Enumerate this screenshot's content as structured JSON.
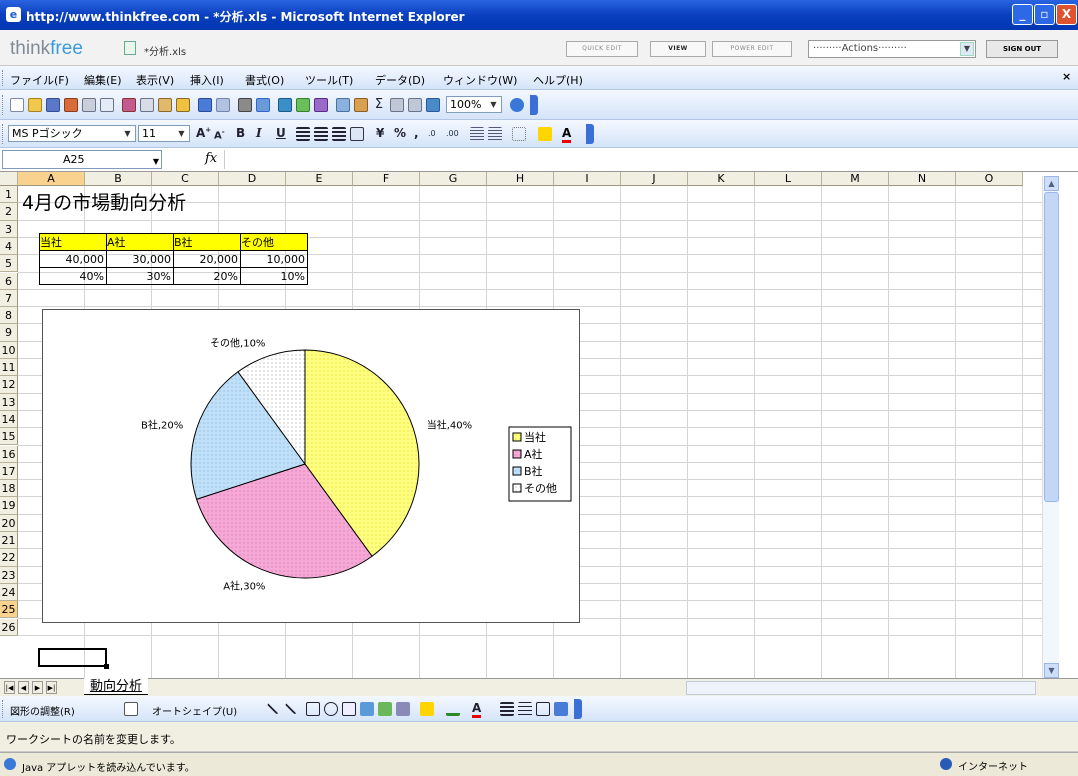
{
  "window": {
    "title": "http://www.thinkfree.com - *分析.xls - Microsoft Internet Explorer",
    "minimize": "_",
    "maximize": "▫",
    "close": "X"
  },
  "thinkfree": {
    "logo_a": "think",
    "logo_b": "free",
    "filename": "*分析.xls",
    "buttons": [
      "QUICK EDIT",
      "VIEW",
      "POWER EDIT"
    ],
    "actions": "·········Actions·········",
    "signout": "SIGN OUT"
  },
  "menu": [
    "ファイル(F)",
    "編集(E)",
    "表示(V)",
    "挿入(I)",
    "書式(O)",
    "ツール(T)",
    "データ(D)",
    "ウィンドウ(W)",
    "ヘルプ(H)"
  ],
  "toolbar": {
    "zoom": "100%",
    "font_name": "MS Pゴシック",
    "font_size": "11",
    "bold": "B",
    "italic": "I",
    "underline": "U",
    "currency": "¥",
    "percent": "%",
    "comma": ","
  },
  "formula_bar": {
    "name_box": "A25",
    "fx": "fx",
    "value": ""
  },
  "columns": [
    "A",
    "B",
    "C",
    "D",
    "E",
    "F",
    "G",
    "H",
    "I",
    "J",
    "K",
    "L",
    "M",
    "N",
    "O"
  ],
  "rows": [
    "1",
    "2",
    "3",
    "4",
    "5",
    "6",
    "7",
    "8",
    "9",
    "10",
    "11",
    "12",
    "13",
    "14",
    "15",
    "16",
    "17",
    "18",
    "19",
    "20",
    "21",
    "22",
    "23",
    "24",
    "25",
    "26"
  ],
  "sheet": {
    "title": "4月の市場動向分析",
    "headers": [
      "当社",
      "A社",
      "B社",
      "その他"
    ],
    "values": [
      "40,000",
      "30,000",
      "20,000",
      "10,000"
    ],
    "percents": [
      "40%",
      "30%",
      "20%",
      "10%"
    ]
  },
  "chart_data": {
    "type": "pie",
    "categories": [
      "当社",
      "A社",
      "B社",
      "その他"
    ],
    "values": [
      40,
      30,
      20,
      10
    ],
    "data_labels": [
      "当社,40%",
      "A社,30%",
      "B社,20%",
      "その他,10%"
    ],
    "legend": [
      "当社",
      "A社",
      "B社",
      "その他"
    ],
    "legend_position": "right",
    "colors": [
      "#ffff80",
      "#f4a6d3",
      "#b9dcf7",
      "#ffffff"
    ]
  },
  "tabs": {
    "sheet_name": "動向分析"
  },
  "drawing_toolbar": {
    "draw": "図形の調整(R)",
    "autoshape": "オートシェイプ(U)"
  },
  "status": {
    "message": "ワークシートの名前を変更します。",
    "ie_status": "Java アプレットを読み込んでいます。",
    "zone": "インターネット"
  }
}
